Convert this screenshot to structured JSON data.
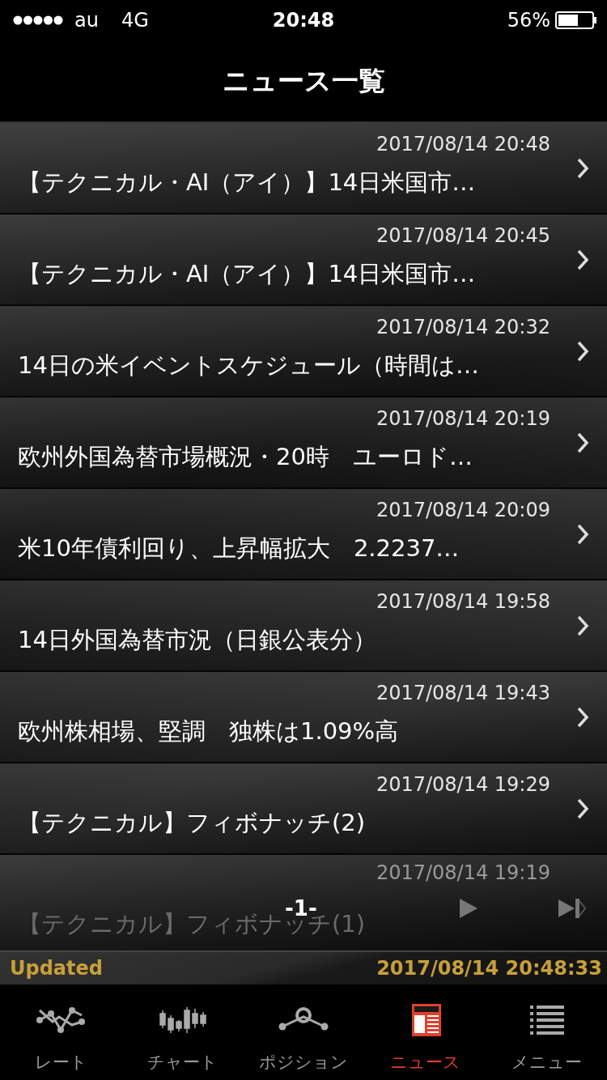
{
  "status_bar": {
    "carrier": "au",
    "network": "4G",
    "time": "20:48",
    "battery": "56%"
  },
  "nav": {
    "title": "ニュース一覧"
  },
  "news": [
    {
      "date": "2017/08/14 20:48",
      "title": "【テクニカル・AI（アイ）】14日米国市…",
      "faded": false
    },
    {
      "date": "2017/08/14 20:45",
      "title": "【テクニカル・AI（アイ）】14日米国市…",
      "faded": false
    },
    {
      "date": "2017/08/14 20:32",
      "title": "14日の米イベントスケジュール（時間は…",
      "faded": false
    },
    {
      "date": "2017/08/14 20:19",
      "title": "欧州外国為替市場概況・20時　ユーロド…",
      "faded": false
    },
    {
      "date": "2017/08/14 20:09",
      "title": "米10年債利回り、上昇幅拡大　2.2237…",
      "faded": false
    },
    {
      "date": "2017/08/14 19:58",
      "title": "14日外国為替市況（日銀公表分）",
      "faded": false
    },
    {
      "date": "2017/08/14 19:43",
      "title": "欧州株相場、堅調　独株は1.09%高",
      "faded": false
    },
    {
      "date": "2017/08/14 19:29",
      "title": "【テクニカル】フィボナッチ(2)",
      "faded": false
    },
    {
      "date": "2017/08/14 19:19",
      "title": "【テクニカル】フィボナッチ(1)",
      "faded": true
    }
  ],
  "pager": {
    "page": "-1-"
  },
  "updated": {
    "label": "Updated",
    "timestamp": "2017/08/14 20:48:33"
  },
  "tabs": [
    {
      "kind": "rate",
      "label": "レート",
      "selected": false
    },
    {
      "kind": "chart",
      "label": "チャート",
      "selected": false
    },
    {
      "kind": "position",
      "label": "ポジション",
      "selected": false
    },
    {
      "kind": "news",
      "label": "ニュース",
      "selected": true
    },
    {
      "kind": "menu",
      "label": "メニュー",
      "selected": false
    }
  ]
}
